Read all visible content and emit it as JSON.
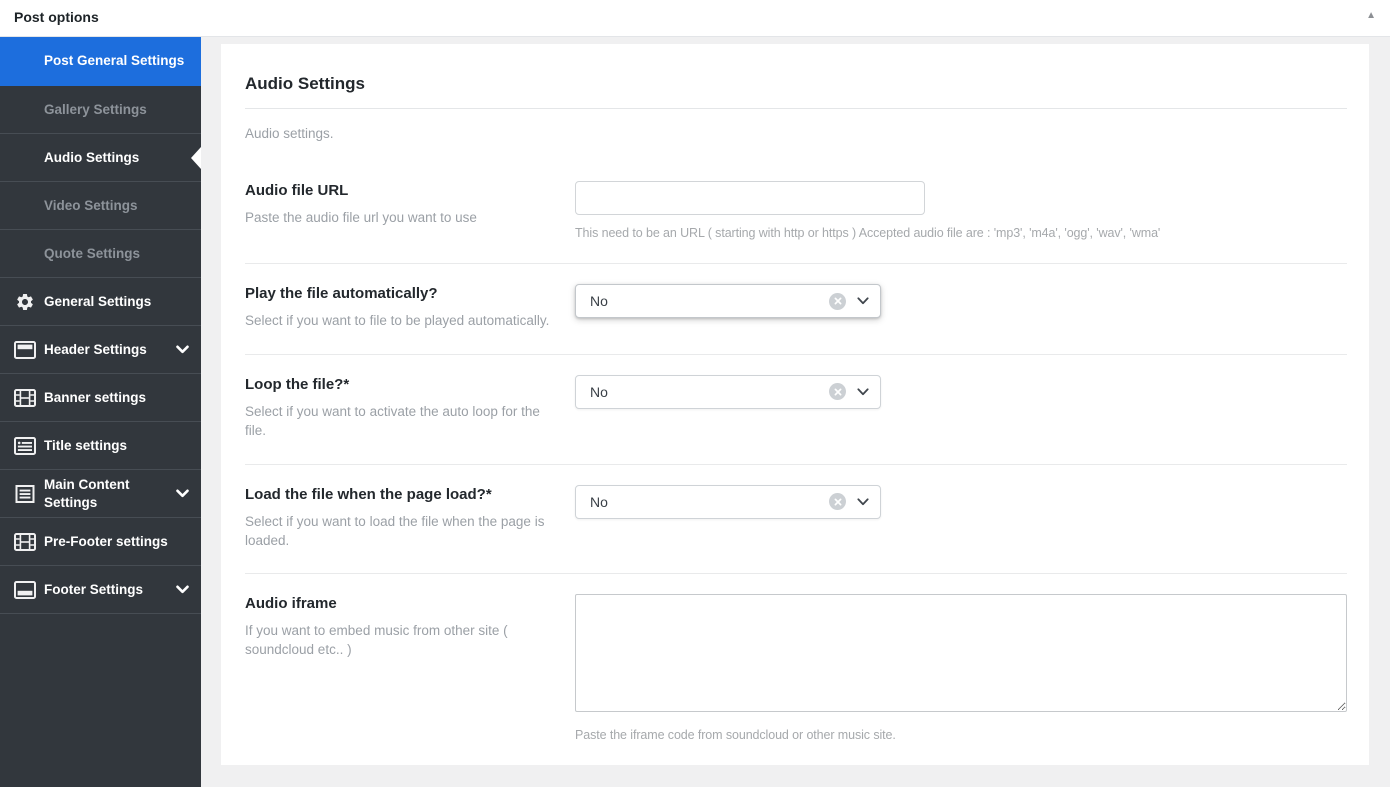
{
  "colors": {
    "accent_blue": "#1d6edd",
    "sidebar_bg": "#32373d",
    "sidebar_muted_text": "#8d939a",
    "panel_bg": "#ffffff",
    "page_bg": "#f0f0f1",
    "label_text": "#23282d",
    "desc_text": "#9ba0a6"
  },
  "header": {
    "title": "Post options",
    "collapse_icon": "▲"
  },
  "sidebar": {
    "items": [
      {
        "label": "Post General Settings",
        "icon": null,
        "state": "selected",
        "chevron": false
      },
      {
        "label": "Gallery Settings",
        "icon": null,
        "state": "muted",
        "chevron": false
      },
      {
        "label": "Audio Settings",
        "icon": null,
        "state": "current",
        "chevron": false
      },
      {
        "label": "Video Settings",
        "icon": null,
        "state": "muted",
        "chevron": false
      },
      {
        "label": "Quote Settings",
        "icon": null,
        "state": "muted",
        "chevron": false
      },
      {
        "label": "General Settings",
        "icon": "gear-icon",
        "state": "normal",
        "chevron": false
      },
      {
        "label": "Header Settings",
        "icon": "header-icon",
        "state": "normal",
        "chevron": true
      },
      {
        "label": "Banner settings",
        "icon": "filmstrip-icon",
        "state": "normal",
        "chevron": false
      },
      {
        "label": "Title settings",
        "icon": "title-list-icon",
        "state": "normal",
        "chevron": false
      },
      {
        "label": "Main Content Settings",
        "icon": "content-lines-icon",
        "state": "normal",
        "chevron": true
      },
      {
        "label": "Pre-Footer settings",
        "icon": "filmstrip-icon",
        "state": "normal",
        "chevron": false
      },
      {
        "label": "Footer Settings",
        "icon": "footer-icon",
        "state": "normal",
        "chevron": true
      }
    ]
  },
  "panel": {
    "title": "Audio Settings",
    "subtitle": "Audio settings.",
    "fields": [
      {
        "type": "text",
        "label": "Audio file URL",
        "desc": "Paste the audio file url you want to use",
        "value": "",
        "hint": "This need to be an URL ( starting with http or https ) Accepted audio file are : 'mp3', 'm4a', 'ogg', 'wav', 'wma'"
      },
      {
        "type": "select",
        "label": "Play the file automatically?",
        "desc": "Select if you want to file to be played automatically.",
        "value": "No"
      },
      {
        "type": "select",
        "label": "Loop the file?*",
        "desc": "Select if you want to activate the auto loop for the file.",
        "value": "No"
      },
      {
        "type": "select",
        "label": "Load the file when the page load?*",
        "desc": "Select if you want to load the file when the page is loaded.",
        "value": "No"
      },
      {
        "type": "textarea",
        "label": "Audio iframe",
        "desc": "If you want to embed music from other site ( soundcloud etc.. )",
        "value": "",
        "hint": "Paste the iframe code from soundcloud or other music site."
      }
    ]
  }
}
